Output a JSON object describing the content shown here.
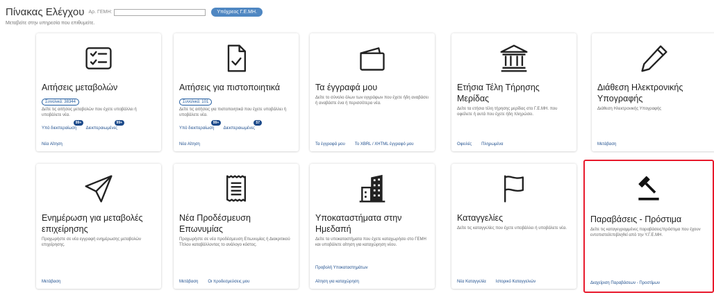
{
  "header": {
    "title": "Πίνακας Ελέγχου",
    "gemh_label": "Αρ. ΓΕΜΗ:",
    "gemh_value": "",
    "obligated_badge": "Υπόχρεος Γ.Ε.ΜΗ.",
    "subtitle": "Μεταβείτε στην υπηρεσία που επιθυμείτε."
  },
  "cards": [
    {
      "title": "Αιτήσεις μεταβολών",
      "total": "Συνολικά: 38344",
      "desc": "Δείτε τις αιτήσεις μεταβολών που έχετε υποβάλλει ή υποβάλετε νέα.",
      "status": [
        {
          "label": "Υπό διεκπεραίωση",
          "count": "99+"
        },
        {
          "label": "Διεκπεραιωμένες",
          "count": "99+"
        }
      ],
      "actions": [
        "Νέα Αίτηση"
      ]
    },
    {
      "title": "Αιτήσεις για πιστοποιητικά",
      "total": "Συνολικά: 101",
      "desc": "Δείτε τις αιτήσεις για πιστοποιητικά που έχετε υποβάλλει ή υποβάλετε νέα.",
      "status": [
        {
          "label": "Υπό διεκπεραίωση",
          "count": "99+"
        },
        {
          "label": "Διεκπεραιωμένες",
          "count": "57"
        }
      ],
      "actions": [
        "Νέα Αίτηση"
      ]
    },
    {
      "title": "Τα έγγραφά μου",
      "desc": "Δείτε το σύνολο όλων των εγγράφων που έχετε ήδη αναβάσει ή αναβάστε ένα ή περισσότερα νέα.",
      "actions": [
        "Τα έγγραφά μου",
        "Το XBRL / XHTML έγγραφό μου"
      ]
    },
    {
      "title": "Ετήσια Τέλη Τήρησης Μερίδας",
      "desc": "Δείτε τα ετήσια τέλη τήρησης μερίδας στο Γ.Ε.ΜΗ. που οφείλετε ή αυτά που έχετε ήδη πληρώσει.",
      "actions": [
        "Οφειλές",
        "Πληρωμένα"
      ]
    },
    {
      "title": "Διάθεση Ηλεκτρονικής Υπογραφής",
      "desc": "Διάθεση Ηλεκτρονικής Υπογραφής",
      "actions": [
        "Μετάβαση"
      ]
    },
    {
      "title": "Ενημέρωση για μεταβολές επιχείρησης",
      "desc": "Προχωρήστε σε νέα εγγραφή ενημέρωσης μεταβολών επιχείρησης.",
      "actions": [
        "Μετάβαση"
      ]
    },
    {
      "title": "Νέα Προδέσμευση Επωνυμίας",
      "desc": "Προχωρήστε σε νέα προδέσμευση Επωνυμίας ή Διακριτικού Τίτλου καταβάλλοντας το ανάλογο κόστος.",
      "actions": [
        "Μετάβαση",
        "Οι προδεσμεύσεις μου"
      ]
    },
    {
      "title": "Υποκαταστήματα στην Ημεδαπή",
      "desc": "Δείτε τα υποκαταστήματα που έχετε καταχωρήσει στο ΓΕΜΗ και υποβάλετε αίτηση για καταχώρηση νέου.",
      "extra_link": "Προβολή Υποκαταστημάτων",
      "actions": [
        "Αίτηση για καταχώρηση"
      ]
    },
    {
      "title": "Καταγγελίες",
      "desc": "Δείτε τις καταγγελίες που έχετε υποβάλλει ή υποβάλετε νέα.",
      "actions": [
        "Νέα Καταγγελία",
        "Ιστορικό Καταγγελιών"
      ]
    },
    {
      "title": "Παραβάσεις - Πρόστιμα",
      "desc": "Δείτε τις καταγεγραμμένες παραβάσεις/πρόστιμα που έχουν εντοπιστεί/επιβληθεί από την Υ.Γ.Ε.ΜΗ.",
      "actions": [
        "Διαχείριση Παραβάσεων - Προστίμων"
      ]
    }
  ],
  "icons": [
    "checklist-icon",
    "document-check-icon",
    "wallet-icon",
    "institution-icon",
    "pen-icon",
    "send-icon",
    "receipt-icon",
    "buildings-icon",
    "flag-icon",
    "gavel-icon"
  ],
  "colors": {
    "link": "#1f4f8e",
    "badge": "#4f87c2",
    "highlight_border": "#e8192c",
    "count_bubble": "#1c4a8a"
  }
}
